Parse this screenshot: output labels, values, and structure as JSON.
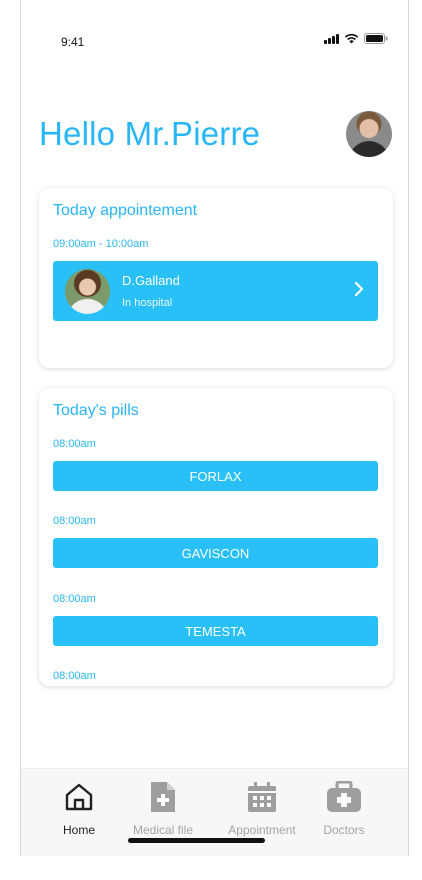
{
  "status_bar": {
    "time": "9:41"
  },
  "header": {
    "greeting": "Hello Mr.Pierre",
    "avatar_icon": "user-avatar"
  },
  "appointment_card": {
    "title": "Today appointement",
    "time": "09:00am - 10:00am",
    "doctor_name": "D.Galland",
    "location": "In hospital"
  },
  "pills_card": {
    "title": "Today's pills",
    "pills": [
      {
        "time": "08:00am",
        "name": "FORLAX"
      },
      {
        "time": "08:00am",
        "name": "GAVISCON"
      },
      {
        "time": "08:00am",
        "name": "TEMESTA"
      },
      {
        "time": "08:00am",
        "name": ""
      }
    ]
  },
  "bottom_nav": {
    "items": [
      {
        "label": "Home",
        "icon": "home-icon",
        "active": true
      },
      {
        "label": "Medical file",
        "icon": "medical-file-icon",
        "active": false
      },
      {
        "label": "Appointment",
        "icon": "calendar-icon",
        "active": false
      },
      {
        "label": "Doctors",
        "icon": "medical-kit-icon",
        "active": false
      }
    ]
  },
  "colors": {
    "accent": "#29b6f6",
    "button": "#29c0f8",
    "inactive_nav": "#a3a3a3",
    "active_nav": "#222222"
  }
}
